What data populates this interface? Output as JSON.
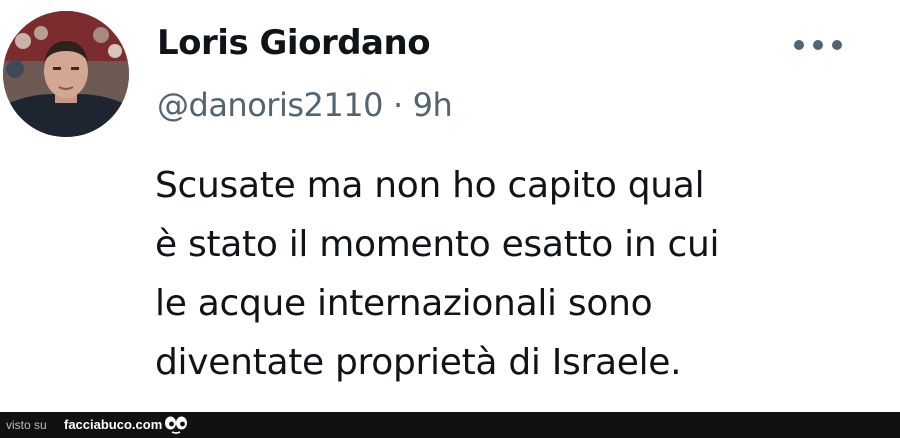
{
  "tweet": {
    "author_name": "Loris Giordano",
    "handle": "@danoris2110",
    "separator": "·",
    "time": "9h",
    "text": "Scusate ma non ho capito qual\nè stato il momento esatto in cui\nle acque internazionali sono\ndiventate proprietà di Israele.",
    "more_icon": "more-horizontal-icon",
    "colors": {
      "text": "#0f1419",
      "secondary": "#536471"
    }
  },
  "footer": {
    "prefix": "visto su",
    "site": "facciabuco.com",
    "logo_icon": "eyes-icon",
    "background": "#111111"
  }
}
